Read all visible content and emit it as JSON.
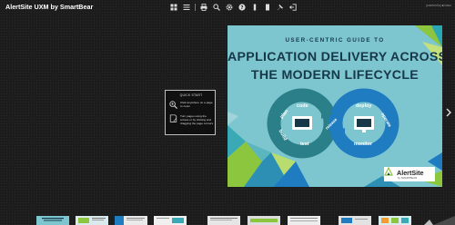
{
  "app": {
    "title": "AlertSite UXM by SmartBear",
    "powered_by": "powered by ■ issuu"
  },
  "toolbar": {
    "icons": [
      "thumbnails-icon",
      "list-icon",
      "print-icon",
      "search-icon",
      "settings-icon",
      "help-icon",
      "fullscreen-icon",
      "page-view-icon",
      "pin-icon",
      "share-icon",
      "exit-icon"
    ]
  },
  "quickstart": {
    "title": "QUICK START",
    "step1": "Click anywhere on a page to zoom",
    "step2": "Turn pages using the arrows or by clicking and dragging the page corners"
  },
  "cover": {
    "subtitle": "USER-CENTRIC GUIDE TO",
    "title_line1": "APPLICATION DELIVERY ACROSS",
    "title_line2": "THE MODERN LIFECYCLE",
    "cycle_labels": {
      "code": "code",
      "plan": "plan",
      "build": "build",
      "test": "test",
      "release": "release",
      "deploy": "deploy",
      "operate": "operate",
      "monitor": "monitor"
    },
    "brand_name": "AlertSite",
    "brand_by": "by SMARTBEAR"
  },
  "colors": {
    "background": "#1c1c1c",
    "cover_teal": "#7ec6cf",
    "cover_navy": "#173848",
    "accent_green": "#8cc63f",
    "accent_blue": "#1f7cc1"
  }
}
